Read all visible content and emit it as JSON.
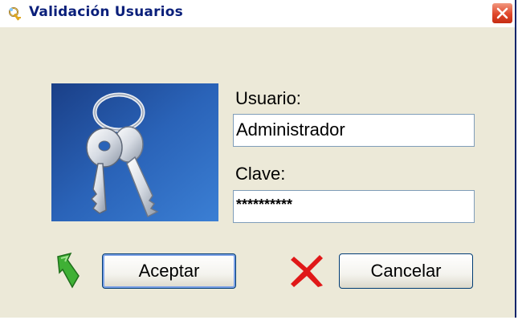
{
  "window": {
    "title": "Validación Usuarios"
  },
  "form": {
    "user_label": "Usuario:",
    "user_value": "Administrador",
    "password_label": "Clave:",
    "password_value": "**********"
  },
  "buttons": {
    "ok_label": "Aceptar",
    "cancel_label": "Cancelar"
  },
  "icons": {
    "title": "keys-icon",
    "close": "close-icon",
    "image": "keys-image",
    "ok": "green-arrow-icon",
    "cancel": "red-x-icon"
  },
  "colors": {
    "dialog_bg": "#ece9d8",
    "title_text": "#0a1f7a",
    "close_button": "#e0472b",
    "image_bg": "#1e4f9c"
  }
}
